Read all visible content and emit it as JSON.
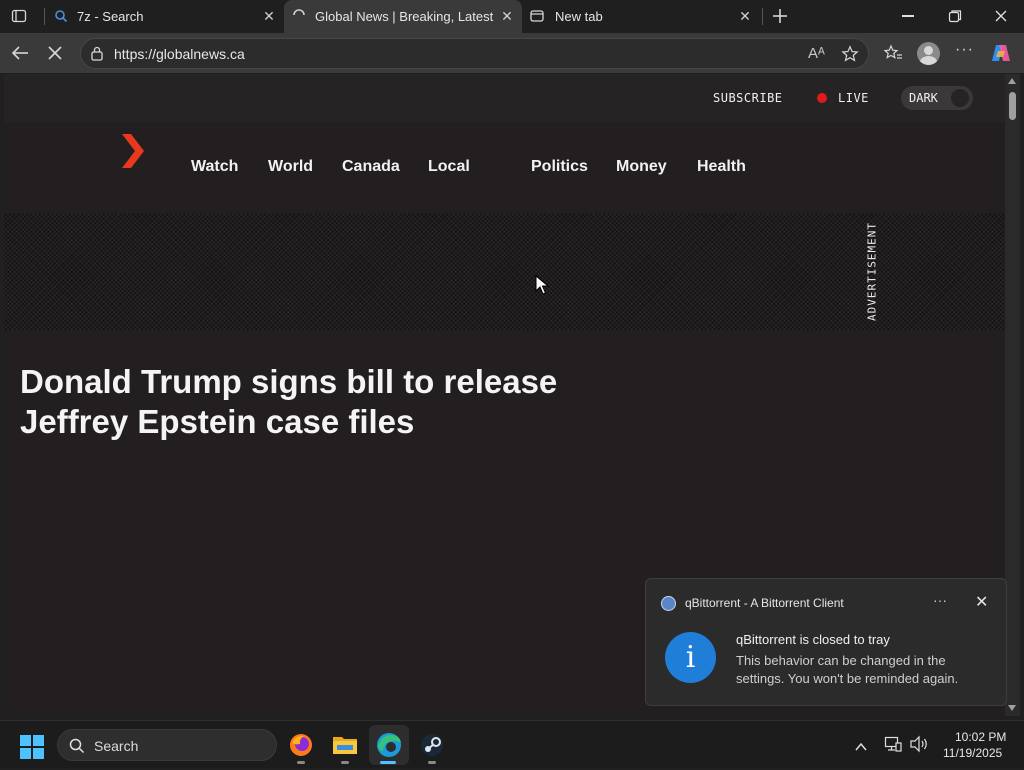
{
  "browser": {
    "tabs": [
      {
        "title": "7z - Search",
        "icon": "search-icon",
        "active": false
      },
      {
        "title": "Global News | Breaking, Latest Ne",
        "icon": "loading-icon",
        "active": true
      },
      {
        "title": "New tab",
        "icon": "newtab-icon",
        "active": false
      }
    ],
    "url": "https://globalnews.ca"
  },
  "page": {
    "subscribe": "SUBSCRIBE",
    "live": "LIVE",
    "dark": "DARK",
    "nav": [
      "Watch",
      "World",
      "Canada",
      "Local",
      "Politics",
      "Money",
      "Health"
    ],
    "ad_label": "ADVERTISEMENT",
    "headline": "Donald Trump signs bill to release Jeffrey Epstein case files"
  },
  "toast": {
    "app": "qBittorrent - A Bittorrent Client",
    "title": "qBittorrent is closed to tray",
    "body": "This behavior can be changed in the settings. You won't be reminded again."
  },
  "taskbar": {
    "search": "Search",
    "time": "10:02 PM",
    "date": "11/19/2025"
  },
  "colors": {
    "brand": "#e8391e",
    "live": "#e01b1b",
    "accent": "#4cc2ff"
  }
}
